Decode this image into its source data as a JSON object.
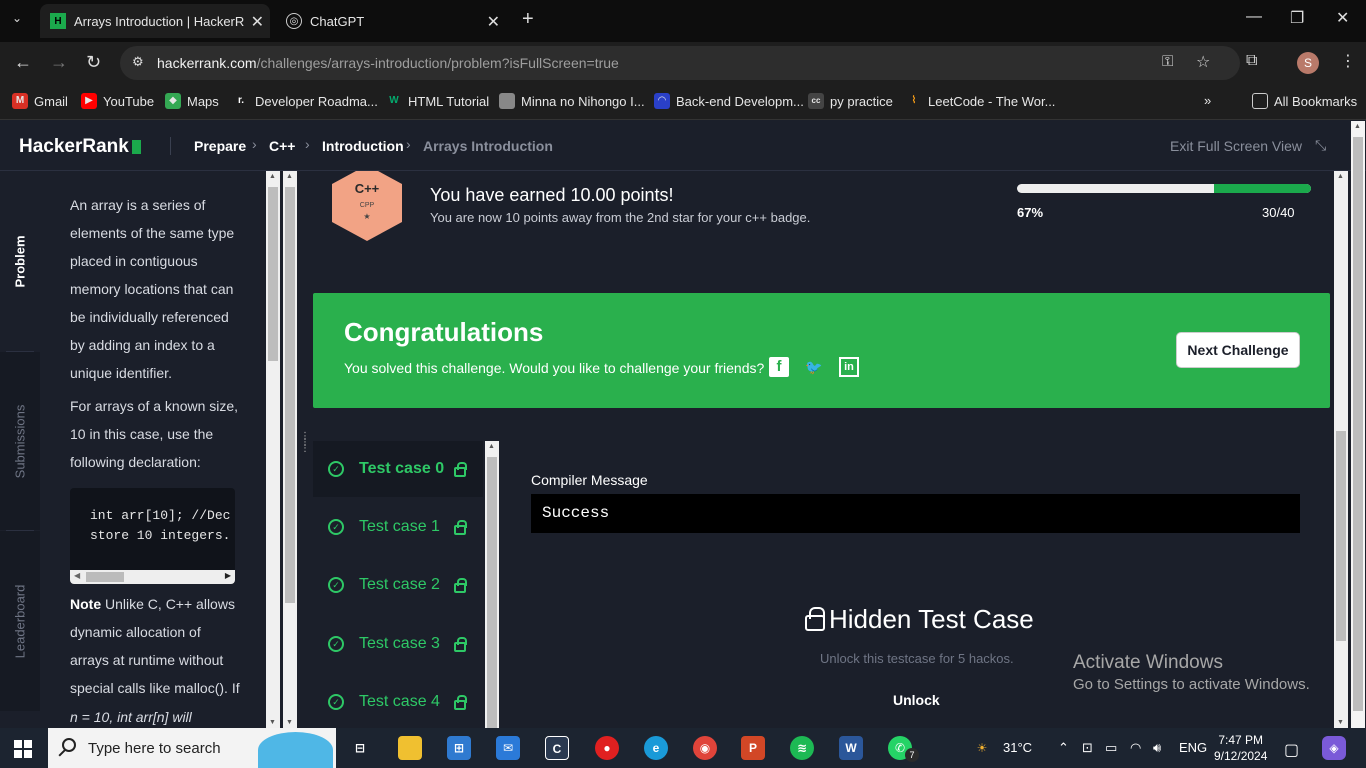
{
  "browser": {
    "tabs": [
      {
        "title": "Arrays Introduction | HackerRa",
        "favicon": "hackerrank-icon",
        "active": true
      },
      {
        "title": "ChatGPT",
        "favicon": "chatgpt-icon",
        "active": false
      }
    ],
    "url_host": "hackerrank.com",
    "url_path": "/challenges/arrays-introduction/problem?isFullScreen=true",
    "profile_initial": "S",
    "bookmarks": [
      {
        "label": "Gmail",
        "icon": "gmail-icon",
        "color": "#d93025"
      },
      {
        "label": "YouTube",
        "icon": "youtube-icon",
        "color": "#ff0000"
      },
      {
        "label": "Maps",
        "icon": "maps-icon",
        "color": "#34a853"
      },
      {
        "label": "Developer Roadma...",
        "icon": "roadmap-icon",
        "color": "#ffffff"
      },
      {
        "label": "HTML Tutorial",
        "icon": "w3schools-icon",
        "color": "#04aa6d"
      },
      {
        "label": "Minna no Nihongo I...",
        "icon": "book-icon",
        "color": "#888888"
      },
      {
        "label": "Back-end Developm...",
        "icon": "freecodecamp-icon",
        "color": "#2a40c8"
      },
      {
        "label": "py practice",
        "icon": "cc-icon",
        "color": "#444444"
      },
      {
        "label": "LeetCode - The Wor...",
        "icon": "leetcode-icon",
        "color": "#ffa116"
      }
    ],
    "all_bookmarks": "All Bookmarks"
  },
  "header": {
    "logo_text": "HackerRank",
    "breadcrumb": [
      "Prepare",
      "C++",
      "Introduction",
      "Arrays Introduction"
    ],
    "exit_fullscreen": "Exit Full Screen View"
  },
  "sidetabs": [
    "Problem",
    "Submissions",
    "Leaderboard"
  ],
  "problem": {
    "para1": "An array is a series of elements of the same type placed in contiguous memory locations that can be individually referenced by adding an index to a unique identifier.",
    "para2": "For arrays of a known size, 10 in this case, use the following declaration:",
    "code_line1": "int arr[10]; //Dec",
    "code_line2": "store 10 integers.",
    "note_label": "Note",
    "note_text": " Unlike C, C++ allows dynamic allocation of arrays at runtime without special calls like malloc(). If",
    "last_line": "n = 10, int arr[n] will"
  },
  "badge": {
    "lang": "C++",
    "label": "CPP",
    "star": "★"
  },
  "points": {
    "title": "You have earned 10.00 points!",
    "subtitle": "You are now 10 points away from the 2nd star for your c++ badge.",
    "percent_label": "67%",
    "progress": 0.67,
    "score": "30/40"
  },
  "congrats": {
    "title": "Congratulations",
    "subtitle": "You solved this challenge. Would you like to challenge your friends?",
    "social": [
      {
        "icon": "facebook-icon",
        "glyph": "f"
      },
      {
        "icon": "twitter-icon",
        "glyph": "🐦"
      },
      {
        "icon": "linkedin-icon",
        "glyph": "in"
      }
    ],
    "next_button": "Next Challenge"
  },
  "testcases": [
    "Test case 0",
    "Test case 1",
    "Test case 2",
    "Test case 3",
    "Test case 4"
  ],
  "result": {
    "compiler_label": "Compiler Message",
    "compiler_output": "Success",
    "hidden_title": "Hidden Test Case",
    "unlock_sub": "Unlock this testcase for 5 hackos.",
    "unlock_button": "Unlock"
  },
  "watermark": {
    "line1": "Activate Windows",
    "line2": "Go to Settings to activate Windows."
  },
  "taskbar": {
    "search_placeholder": "Type here to search",
    "weather": "31°C",
    "lang": "ENG",
    "time": "7:47 PM",
    "date": "9/12/2024",
    "whatsapp_badge": "7"
  }
}
